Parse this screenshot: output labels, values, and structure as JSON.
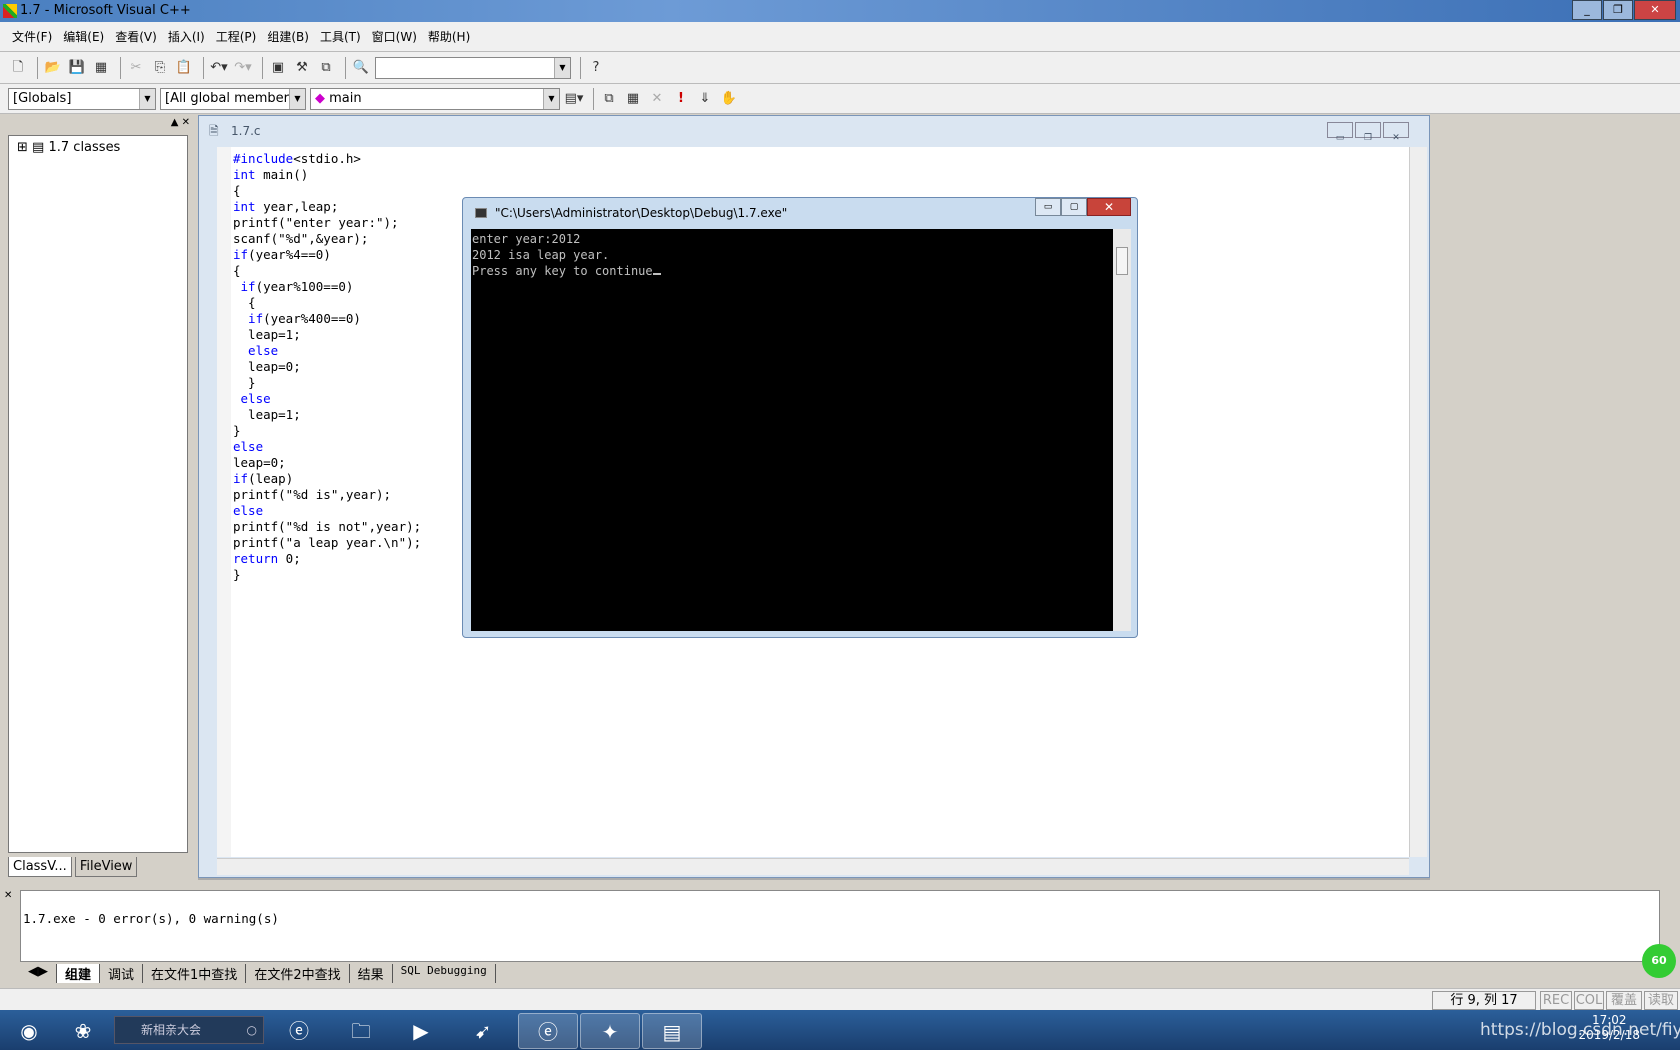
{
  "window": {
    "title": "1.7 - Microsoft Visual C++"
  },
  "menu": [
    "文件(F)",
    "编辑(E)",
    "查看(V)",
    "插入(I)",
    "工程(P)",
    "组建(B)",
    "工具(T)",
    "窗口(W)",
    "帮助(H)"
  ],
  "toolbar2": {
    "scope": "[Globals]",
    "members": "[All global members",
    "function": "main"
  },
  "left_pane": {
    "tree_root": "1.7 classes",
    "tabs": [
      "ClassV...",
      "FileView"
    ]
  },
  "editor": {
    "tab_title": "1.7.c",
    "lines": [
      [
        [
          "kw",
          "#include"
        ],
        [
          "",
          "<stdio.h>"
        ]
      ],
      [
        [
          "kw",
          "int"
        ],
        [
          "",
          " main()"
        ]
      ],
      [
        [
          "",
          "{"
        ]
      ],
      [
        [
          "kw",
          "int"
        ],
        [
          "",
          " year,leap;"
        ]
      ],
      [
        [
          "",
          "printf(\"enter year:\");"
        ]
      ],
      [
        [
          "",
          "scanf(\"%d\",&year);"
        ]
      ],
      [
        [
          "kw",
          "if"
        ],
        [
          "",
          "(year%4==0)"
        ]
      ],
      [
        [
          "",
          "{"
        ]
      ],
      [
        [
          "",
          ""
        ],
        [
          "kw",
          " if"
        ],
        [
          "",
          "(year%100==0)"
        ]
      ],
      [
        [
          "",
          "  {"
        ]
      ],
      [
        [
          "",
          ""
        ],
        [
          "kw",
          "  if"
        ],
        [
          "",
          "(year%400==0)"
        ]
      ],
      [
        [
          "",
          "  leap=1;"
        ]
      ],
      [
        [
          "",
          ""
        ],
        [
          "kw",
          "  else"
        ]
      ],
      [
        [
          "",
          "  leap=0;"
        ]
      ],
      [
        [
          "",
          "  }"
        ]
      ],
      [
        [
          "",
          ""
        ],
        [
          "kw",
          " else"
        ]
      ],
      [
        [
          "",
          "  leap=1;"
        ]
      ],
      [
        [
          "",
          "}"
        ]
      ],
      [
        [
          "kw",
          "else"
        ]
      ],
      [
        [
          "",
          "leap=0;"
        ]
      ],
      [
        [
          "kw",
          "if"
        ],
        [
          "",
          "(leap)"
        ]
      ],
      [
        [
          "",
          "printf(\"%d is\",year);"
        ]
      ],
      [
        [
          "kw",
          "else"
        ]
      ],
      [
        [
          "",
          "printf(\"%d is not\",year);"
        ]
      ],
      [
        [
          "",
          "printf(\"a leap year.\\n\");"
        ]
      ],
      [
        [
          "kw",
          "return"
        ],
        [
          "",
          " 0;"
        ]
      ],
      [
        [
          "",
          "}"
        ]
      ]
    ]
  },
  "console": {
    "title": "\"C:\\Users\\Administrator\\Desktop\\Debug\\1.7.exe\"",
    "lines": [
      "enter year:2012",
      "2012 isa leap year.",
      "Press any key to continue"
    ]
  },
  "output": {
    "text": "1.7.exe - 0 error(s), 0 warning(s)",
    "tabs": [
      "组建",
      "调试",
      "在文件1中查找",
      "在文件2中查找",
      "结果",
      "SQL Debugging"
    ]
  },
  "status": {
    "position": "行 9, 列 17",
    "rec": "REC",
    "col": "COL",
    "ovr": "覆盖",
    "read": "读取"
  },
  "taskbar": {
    "search": "新相亲大会",
    "watermark": "https://blog.csdn.net/fiyang",
    "time": "17:02",
    "date": "2019/2/18",
    "badge": "60"
  }
}
